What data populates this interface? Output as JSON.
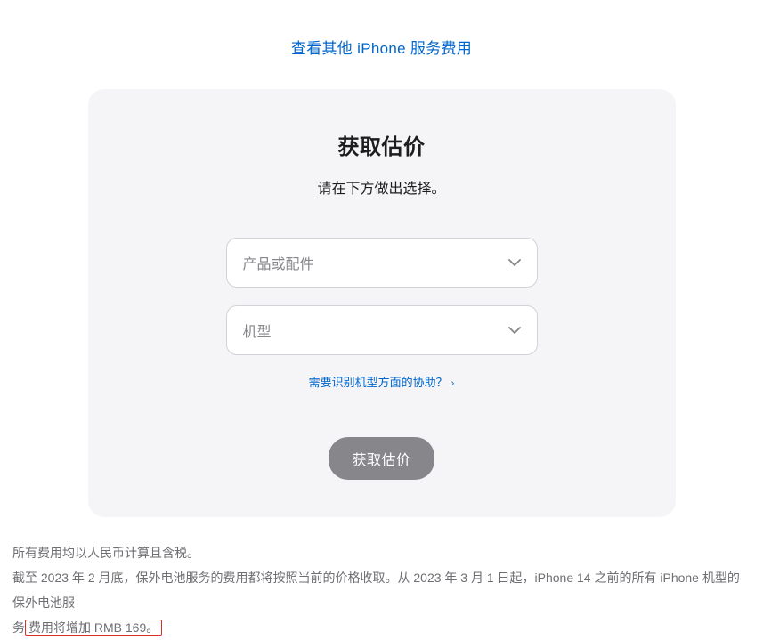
{
  "topLink": {
    "label": "查看其他 iPhone 服务费用"
  },
  "card": {
    "title": "获取估价",
    "subtitle": "请在下方做出选择。",
    "select1": {
      "placeholder": "产品或配件"
    },
    "select2": {
      "placeholder": "机型"
    },
    "helpLink": {
      "label": "需要识别机型方面的协助？"
    },
    "submitButton": {
      "label": "获取估价"
    }
  },
  "footer": {
    "line1": "所有费用均以人民币计算且含税。",
    "line2_part1": "截至 2023 年 2 月底，保外电池服务的费用都将按照当前的价格收取。从 2023 年 3 月 1 日起，iPhone 14 之前的所有 iPhone 机型的保外电池服",
    "line2_part2": "务",
    "line2_highlight": "费用将增加 RMB 169。"
  }
}
